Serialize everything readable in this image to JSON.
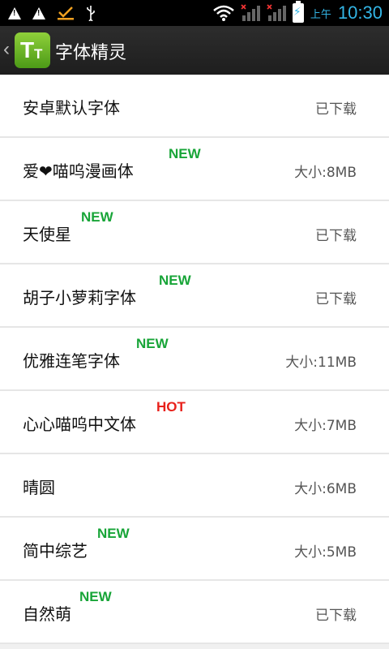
{
  "status_bar": {
    "ampm": "上午",
    "time": "10:30"
  },
  "action_bar": {
    "app_icon_big": "T",
    "app_icon_small": "T",
    "title": "字体精灵"
  },
  "fonts": [
    {
      "name": "安卓默认字体",
      "badge": "",
      "status": "已下载"
    },
    {
      "name": "爱❤喵呜漫画体",
      "badge": "NEW",
      "status": "大小:8MB"
    },
    {
      "name": "天使星",
      "badge": "NEW",
      "status": "已下载"
    },
    {
      "name": "胡子小萝莉字体",
      "badge": "NEW",
      "status": "已下载"
    },
    {
      "name": "优雅连笔字体",
      "badge": "NEW",
      "status": "大小:11MB"
    },
    {
      "name": "心心喵呜中文体",
      "badge": "HOT",
      "status": "大小:7MB"
    },
    {
      "name": "晴圆",
      "badge": "",
      "status": "大小:6MB"
    },
    {
      "name": "简中综艺",
      "badge": "NEW",
      "status": "大小:5MB"
    },
    {
      "name": "自然萌",
      "badge": "NEW",
      "status": "已下载"
    }
  ]
}
